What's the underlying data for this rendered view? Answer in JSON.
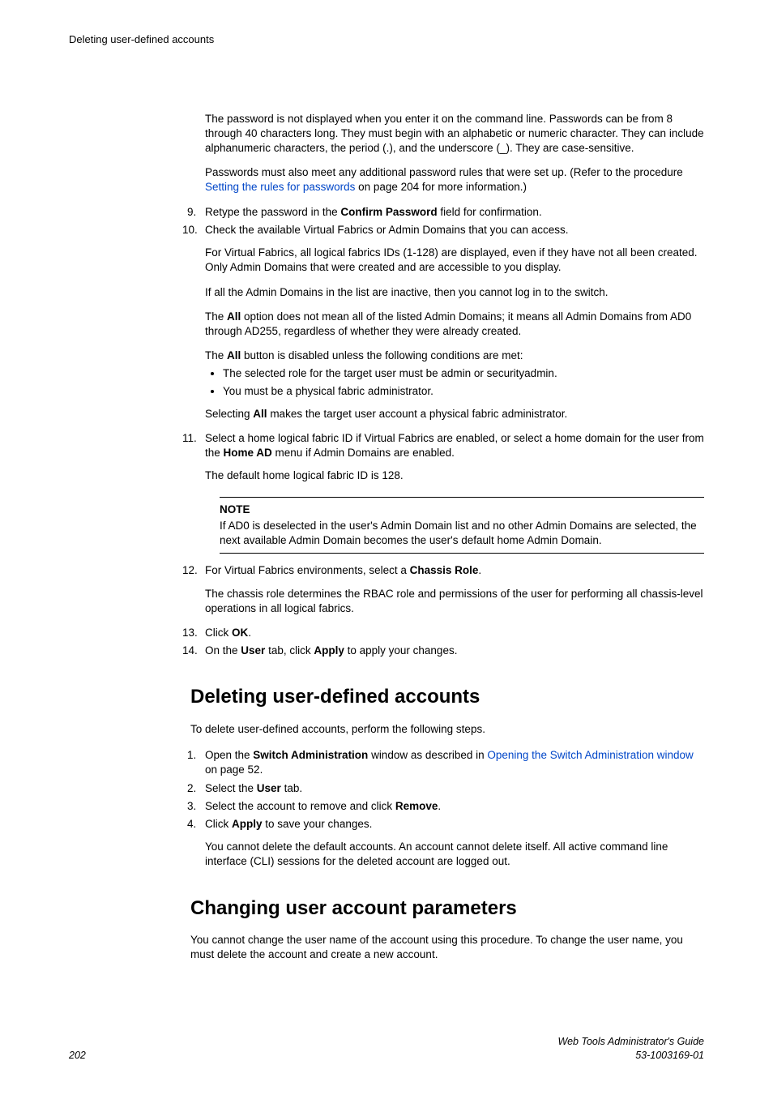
{
  "header": {
    "running": "Deleting user-defined accounts"
  },
  "p": {
    "pwd1": "The password is not displayed when you enter it on the command line. Passwords can be from 8 through 40 characters long. They must begin with an alphabetic or numeric character. They can include alphanumeric characters, the period (.), and the underscore (_). They are case-sensitive.",
    "pwd2a": "Passwords must also meet any additional password rules that were set up. (Refer to the procedure ",
    "pwd2_link": "Setting the rules for passwords",
    "pwd2b": " on page 204 for more information.)",
    "s9a": "Retype the password in the ",
    "s9_bold": "Confirm Password",
    "s9b": " field for confirmation.",
    "s10": "Check the available Virtual Fabrics or Admin Domains that you can access.",
    "s10_p1": "For Virtual Fabrics, all logical fabrics IDs (1-128) are displayed, even if they have not all been created. Only Admin Domains that were created and are accessible to you display.",
    "s10_p2": "If all the Admin Domains in the list are inactive, then you cannot log in to the switch.",
    "s10_p3a": "The ",
    "s10_p3_bold": "All",
    "s10_p3b": " option does not mean all of the listed Admin Domains; it means all Admin Domains from AD0 through AD255, regardless of whether they were already created.",
    "s10_p4a": "The ",
    "s10_p4_bold": "All",
    "s10_p4b": " button is disabled unless the following conditions are met:",
    "bul1": "The selected role for the target user must be admin or securityadmin.",
    "bul2": "You must be a physical fabric administrator.",
    "s10_p5a": "Selecting ",
    "s10_p5_bold": "All",
    "s10_p5b": " makes the target user account a physical fabric administrator.",
    "s11a": "Select a home logical fabric ID if Virtual Fabrics are enabled, or select a home domain for the user from the ",
    "s11_bold": "Home AD",
    "s11b": " menu if Admin Domains are enabled.",
    "s11_p1": "The default home logical fabric ID is 128.",
    "note_label": "NOTE",
    "note_body": "If AD0 is deselected in the user's Admin Domain list and no other Admin Domains are selected, the next available Admin Domain becomes the user's default home Admin Domain.",
    "s12a": "For Virtual Fabrics environments, select a ",
    "s12_bold": "Chassis Role",
    "s12b": ".",
    "s12_p1": "The chassis role determines the RBAC role and permissions of the user for performing all chassis-level operations in all logical fabrics.",
    "s13a": "Click ",
    "s13_bold": "OK",
    "s13b": ".",
    "s14a": "On the ",
    "s14_bold1": "User",
    "s14b": " tab, click ",
    "s14_bold2": "Apply",
    "s14c": " to apply your changes."
  },
  "del": {
    "heading": "Deleting user-defined accounts",
    "intro": "To delete user-defined accounts, perform the following steps.",
    "s1a": "Open the ",
    "s1_bold": "Switch Administration",
    "s1b": " window as described in ",
    "s1_link": "Opening the Switch Administration window",
    "s1c": " on page 52.",
    "s2a": "Select the ",
    "s2_bold": "User",
    "s2b": " tab.",
    "s3a": "Select the account to remove and click ",
    "s3_bold": "Remove",
    "s3b": ".",
    "s4a": "Click ",
    "s4_bold": "Apply",
    "s4b": " to save your changes.",
    "s4_p1": "You cannot delete the default accounts. An account cannot delete itself. All active command line interface (CLI) sessions for the deleted account are logged out."
  },
  "chg": {
    "heading": "Changing user account parameters",
    "intro": "You cannot change the user name of the account using this procedure. To change the user name, you must delete the account and create a new account."
  },
  "footer": {
    "page": "202",
    "title": "Web Tools Administrator's Guide",
    "docnum": "53-1003169-01"
  },
  "nums": {
    "n9": "9.",
    "n10": "10.",
    "n11": "11.",
    "n12": "12.",
    "n13": "13.",
    "n14": "14.",
    "d1": "1.",
    "d2": "2.",
    "d3": "3.",
    "d4": "4."
  }
}
